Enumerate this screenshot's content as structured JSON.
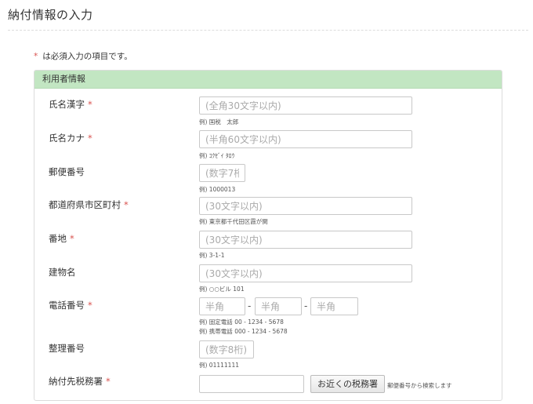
{
  "page": {
    "title": "納付情報の入力"
  },
  "required_note": {
    "marker": "*",
    "text": "は必須入力の項目です。"
  },
  "panel": {
    "title": "利用者情報"
  },
  "fields": {
    "name_kanji": {
      "label": "氏名漢字",
      "required_mark": "*",
      "placeholder": "(全角30文字以内)",
      "hint": "例) 国税　太郎"
    },
    "name_kana": {
      "label": "氏名カナ",
      "required_mark": "*",
      "placeholder": "(半角60文字以内)",
      "hint": "例) ｺｸｾﾞｲ ﾀﾛｳ"
    },
    "postal_code": {
      "label": "郵便番号",
      "placeholder": "(数字7桁)",
      "hint": "例) 1000013"
    },
    "address_city": {
      "label": "都道府県市区町村",
      "required_mark": "*",
      "placeholder": "(30文字以内)",
      "hint": "例) 東京都千代田区霞が関"
    },
    "address_number": {
      "label": "番地",
      "required_mark": "*",
      "placeholder": "(30文字以内)",
      "hint": "例) 3-1-1"
    },
    "building": {
      "label": "建物名",
      "placeholder": "(30文字以内)",
      "hint": "例) ○○ビル 101"
    },
    "phone": {
      "label": "電話番号",
      "required_mark": "*",
      "part1_placeholder": "半角",
      "part2_placeholder": "半角",
      "part3_placeholder": "半角",
      "separator": "-",
      "hint_landline": "例) 固定電話 00 - 1234 - 5678",
      "hint_mobile": "例) 携帯電話 000 - 1234 - 5678"
    },
    "reference_number": {
      "label": "整理番号",
      "placeholder": "(数字8桁)",
      "hint": "例) 01111111"
    },
    "tax_office": {
      "label": "納付先税務署",
      "required_mark": "*",
      "value": "",
      "button_label": "お近くの税務署",
      "button_note": "郵便番号から検索します"
    }
  }
}
